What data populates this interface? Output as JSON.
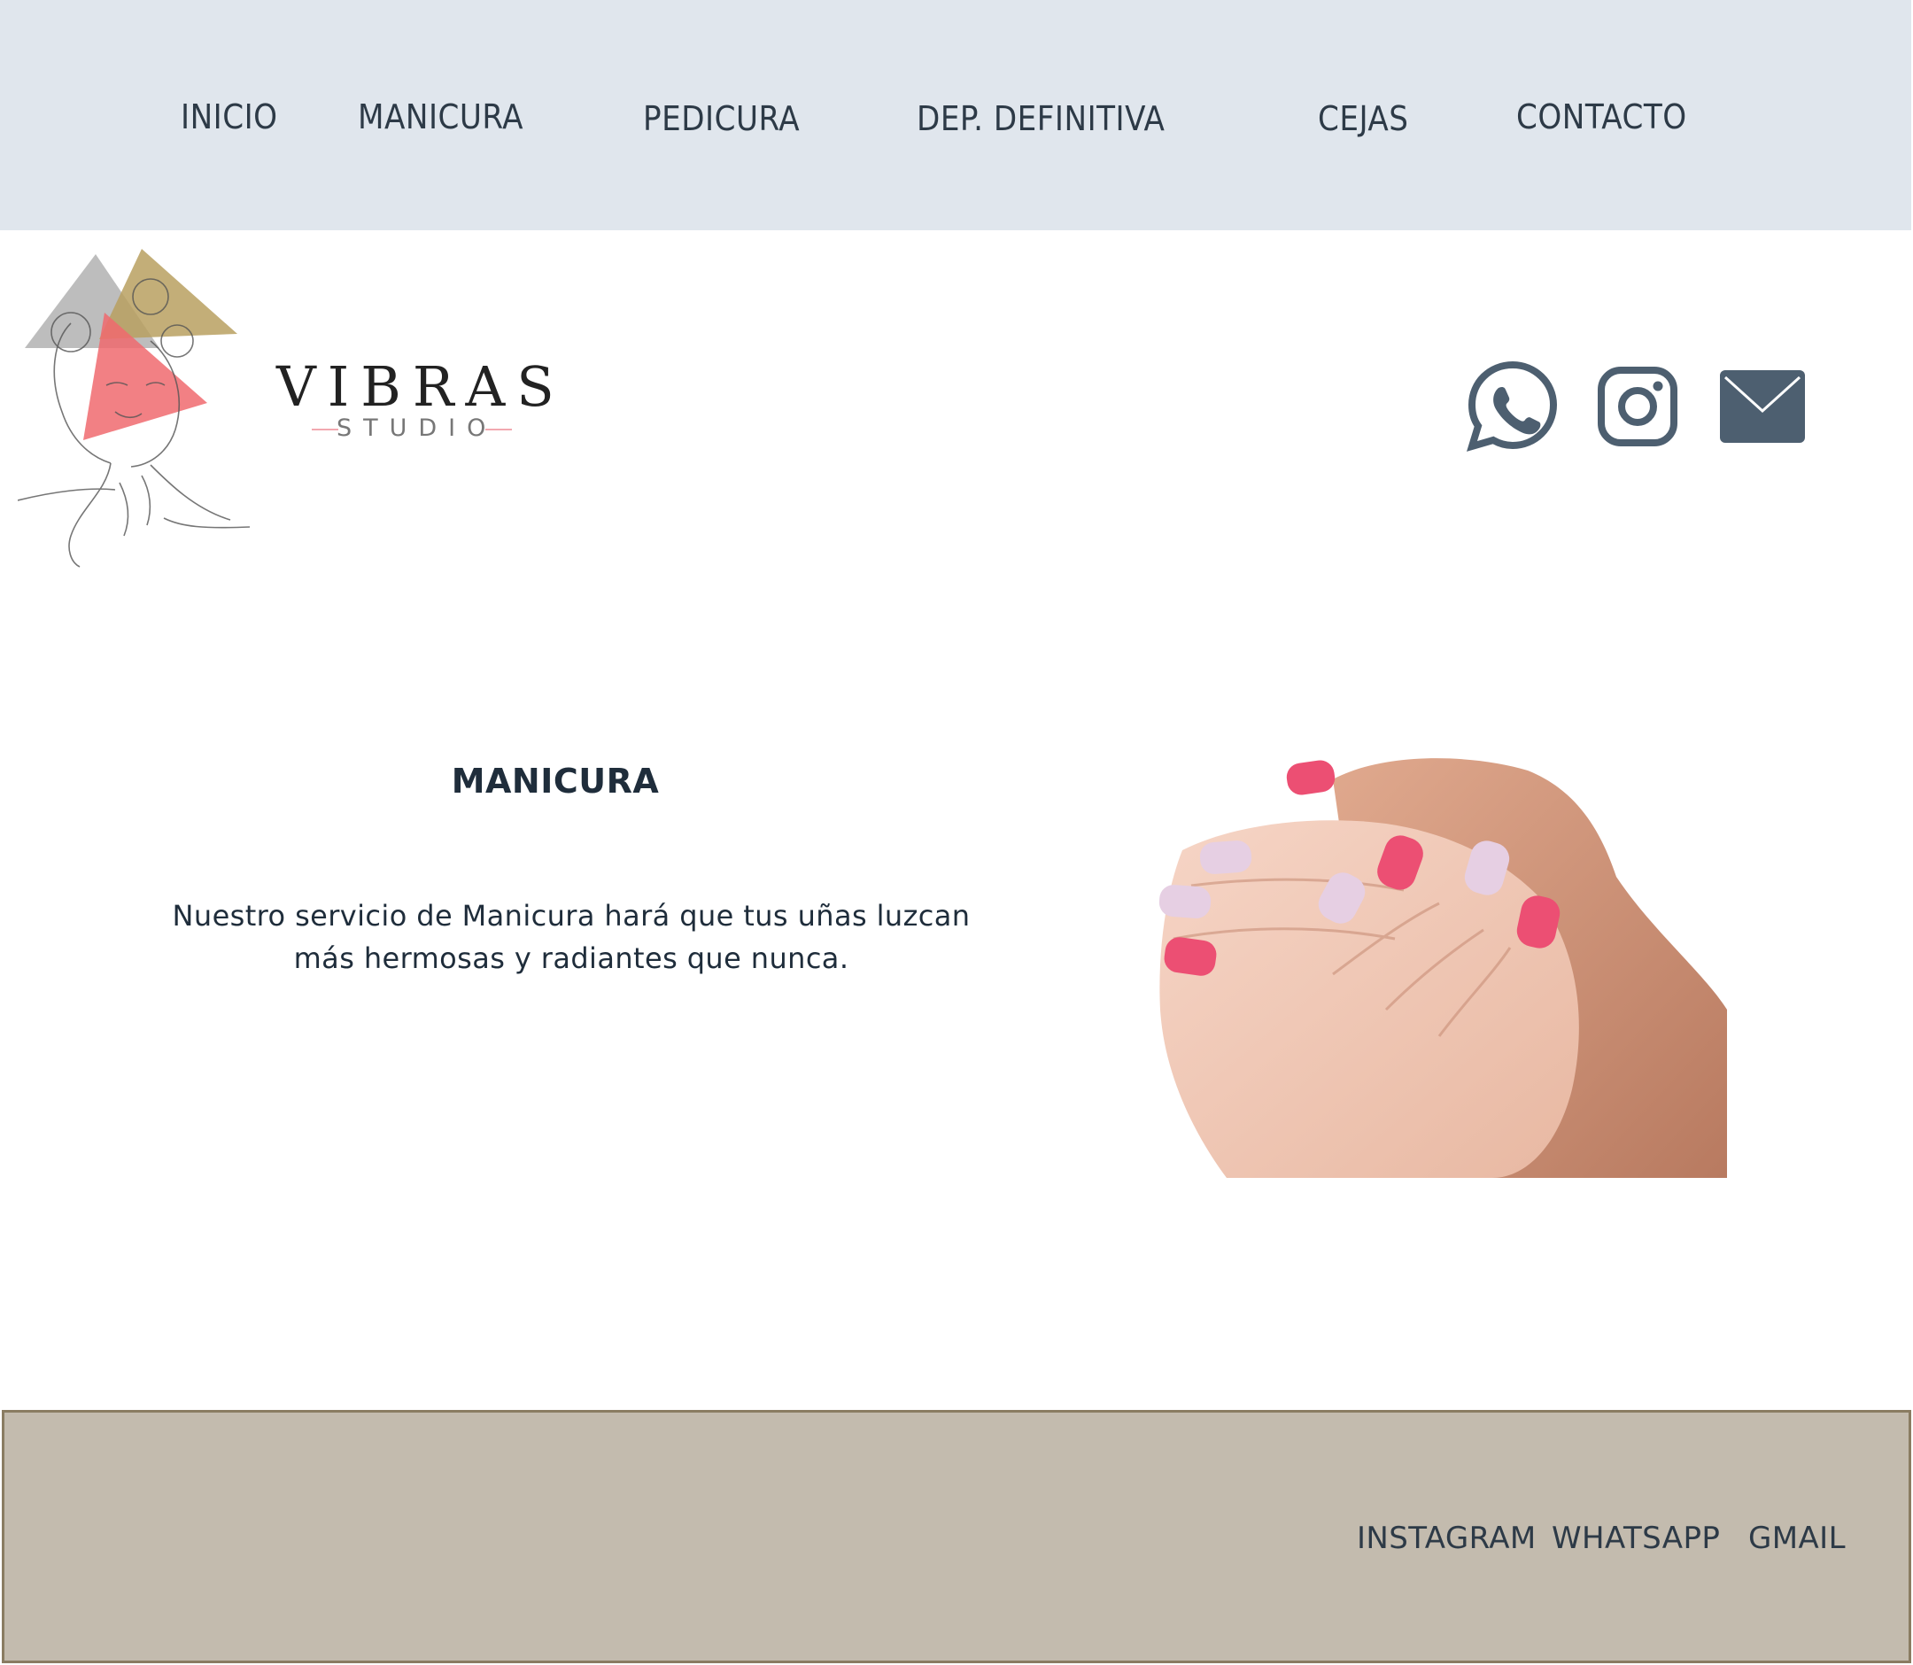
{
  "nav": {
    "items": [
      {
        "label": "INICIO"
      },
      {
        "label": "MANICURA"
      },
      {
        "label": "PEDICURA"
      },
      {
        "label": "DEP. DEFINITIVA"
      },
      {
        "label": "CEJAS"
      },
      {
        "label": "CONTACTO"
      }
    ]
  },
  "logo": {
    "wordmark": "VIBRAS",
    "tagline": "STUDIO"
  },
  "social": {
    "icons": [
      "whatsapp-icon",
      "instagram-icon",
      "mail-icon"
    ],
    "color": "#4d5f70"
  },
  "main": {
    "heading": "MANICURA",
    "description": "Nuestro servicio de Manicura hará que tus uñas luzcan más hermosas y radiantes que nunca."
  },
  "footer": {
    "links": [
      {
        "label": "INSTAGRAM"
      },
      {
        "label": "WHATSAPP"
      },
      {
        "label": "GMAIL"
      }
    ]
  },
  "colors": {
    "nav_bg": "#e0e6ed",
    "footer_bg": "#c3bbae",
    "text": "#2c3845",
    "nail_pink": "#ec4f73",
    "nail_lilac": "#e6cfe3"
  }
}
